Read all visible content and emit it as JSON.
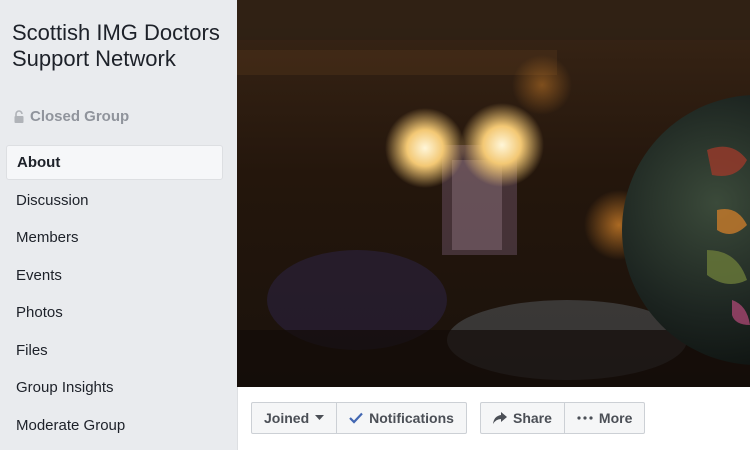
{
  "group": {
    "name": "Scottish IMG Doctors Support Network",
    "privacy": "Closed Group"
  },
  "sidebar": {
    "items": [
      {
        "label": "About",
        "active": true
      },
      {
        "label": "Discussion"
      },
      {
        "label": "Members"
      },
      {
        "label": "Events"
      },
      {
        "label": "Photos"
      },
      {
        "label": "Files"
      },
      {
        "label": "Group Insights"
      },
      {
        "label": "Moderate Group"
      }
    ]
  },
  "actions": {
    "joined_label": "Joined",
    "notifications_label": "Notifications",
    "share_label": "Share",
    "more_label": "More"
  },
  "colors": {
    "accent": "#4267b2",
    "background": "#e9ebee"
  }
}
